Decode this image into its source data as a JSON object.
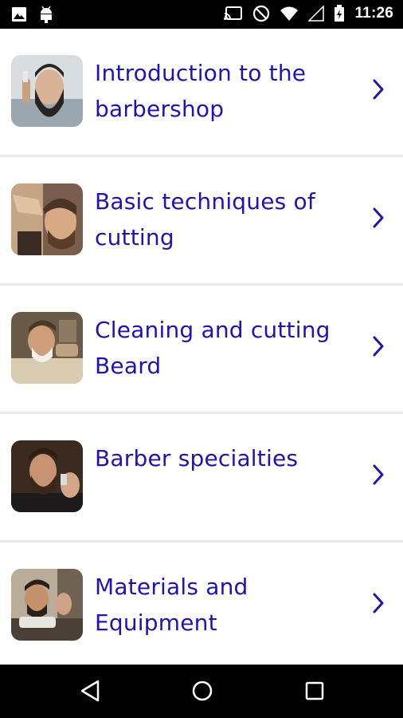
{
  "status_bar": {
    "time": "11:26",
    "icons_left": [
      "image-icon",
      "android-icon"
    ],
    "icons_right": [
      "cast-icon",
      "do-not-disturb-icon",
      "wifi-icon",
      "signal-icon",
      "battery-icon"
    ]
  },
  "list": {
    "items": [
      {
        "title": "Introduction to the barbershop",
        "thumbnail": "bearded-man-photo"
      },
      {
        "title": "Basic techniques of cutting",
        "thumbnail": "haircut-photo"
      },
      {
        "title": "Cleaning and cutting Beard",
        "thumbnail": "beard-shave-photo"
      },
      {
        "title": "Barber specialties",
        "thumbnail": "beard-trim-photo"
      },
      {
        "title": "Materials and Equipment",
        "thumbnail": "barber-chair-photo"
      }
    ]
  },
  "nav_bar": {
    "buttons": [
      "back",
      "home",
      "recents"
    ]
  },
  "colors": {
    "title_text": "#1f16a8",
    "chevron": "#1f16a8",
    "divider": "#eaeaea",
    "system_bars": "#000000"
  }
}
